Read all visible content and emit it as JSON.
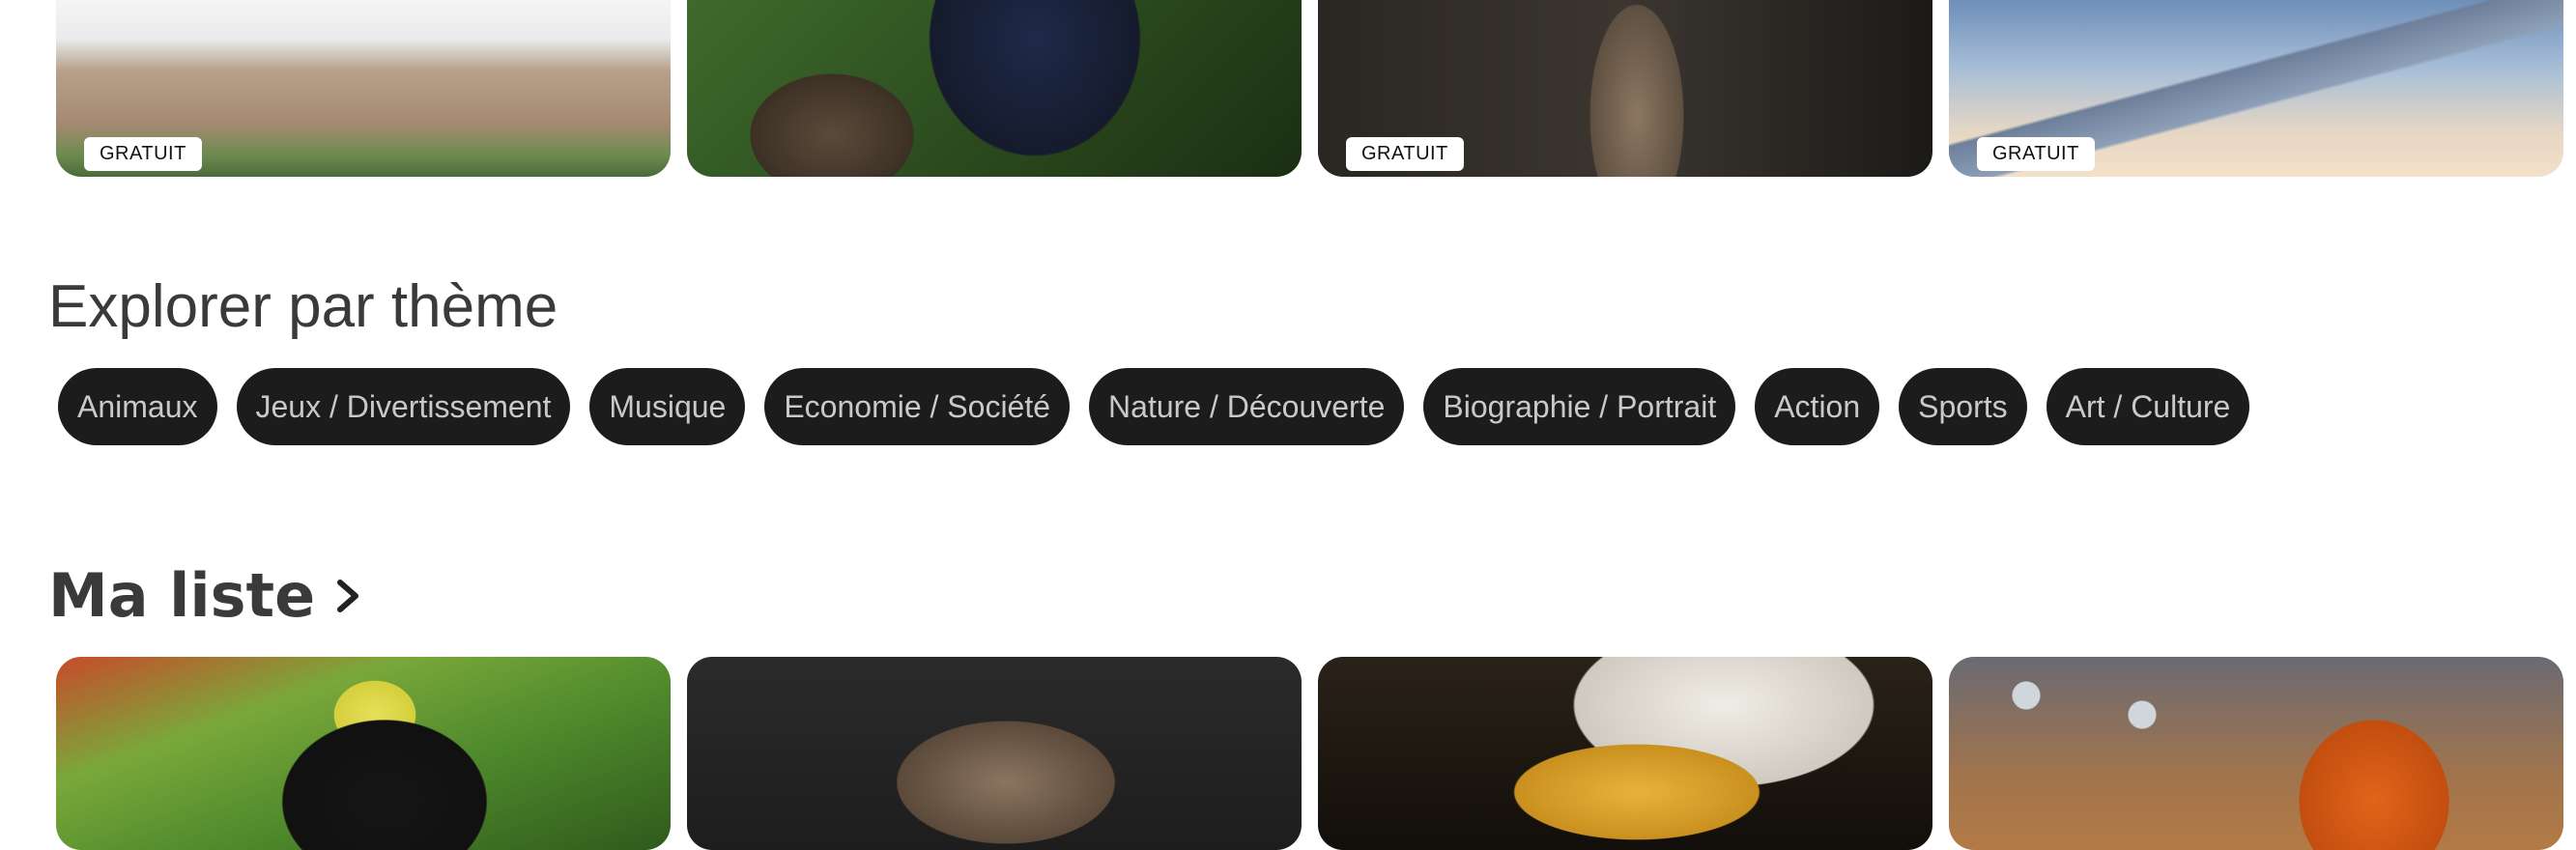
{
  "top_cards": [
    {
      "scene": "beach-aerial",
      "badge": "GRATUIT"
    },
    {
      "scene": "bird-on-branch",
      "badge": ""
    },
    {
      "scene": "meerkat",
      "badge": "GRATUIT"
    },
    {
      "scene": "airplane-wing",
      "badge": "GRATUIT"
    }
  ],
  "explore": {
    "title": "Explorer par thème",
    "themes": [
      "Animaux",
      "Jeux / Divertissement",
      "Musique",
      "Economie / Société",
      "Nature / Découverte",
      "Biographie / Portrait",
      "Action",
      "Sports",
      "Art / Culture"
    ]
  },
  "my_list": {
    "title": "Ma liste",
    "icon": "chevron-right-icon",
    "cards": [
      {
        "scene": "toucan"
      },
      {
        "scene": "meerkat"
      },
      {
        "scene": "eagle"
      },
      {
        "scene": "clownfish"
      }
    ]
  },
  "colors": {
    "chip_bg": "#1c1c1c",
    "chip_text": "#c9c9c9",
    "heading": "#3a3a3a"
  }
}
